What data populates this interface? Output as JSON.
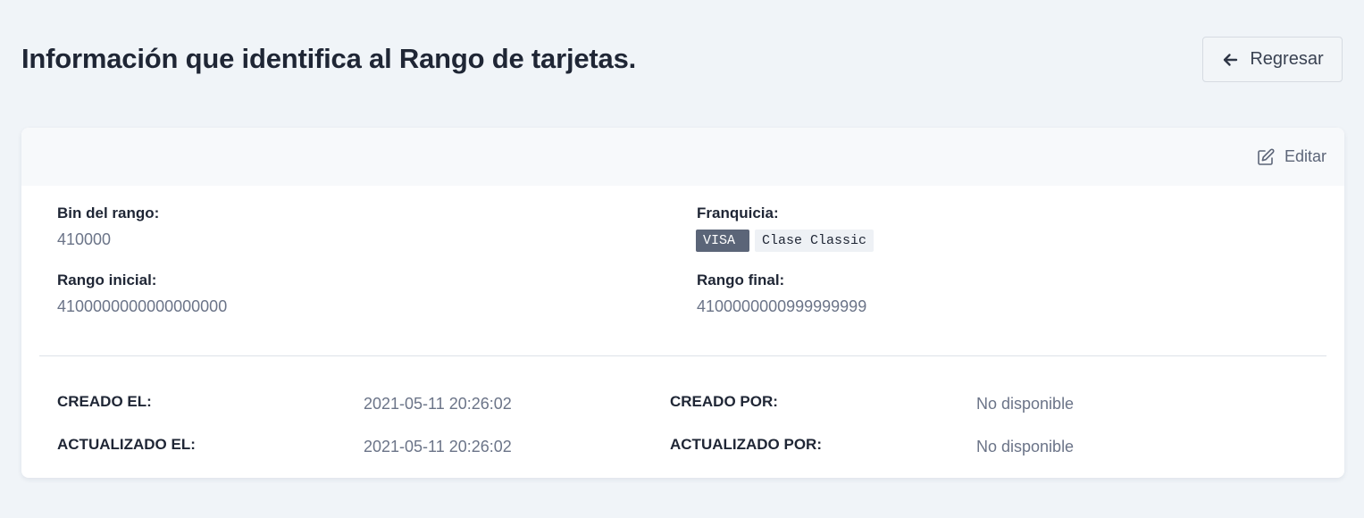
{
  "page": {
    "title": "Información que identifica al Rango de tarjetas.",
    "back_label": "Regresar"
  },
  "card": {
    "edit_label": "Editar",
    "fields": {
      "bin_label": "Bin del rango:",
      "bin_value": "410000",
      "franchise_label": "Franquicia:",
      "franchise_badge": "VISA",
      "class_badge": "Clase Classic",
      "start_label": "Rango inicial:",
      "start_value": "4100000000000000000",
      "end_label": "Rango final:",
      "end_value": "4100000000999999999"
    },
    "audit": {
      "created_at_label": "CREADO EL:",
      "created_at_value": "2021-05-11 20:26:02",
      "created_by_label": "CREADO POR:",
      "created_by_value": "No disponible",
      "updated_at_label": "ACTUALIZADO EL:",
      "updated_at_value": "2021-05-11 20:26:02",
      "updated_by_label": "ACTUALIZADO POR:",
      "updated_by_value": "No disponible"
    }
  },
  "icons": {
    "back": "arrow-left-icon",
    "edit": "edit-icon"
  }
}
